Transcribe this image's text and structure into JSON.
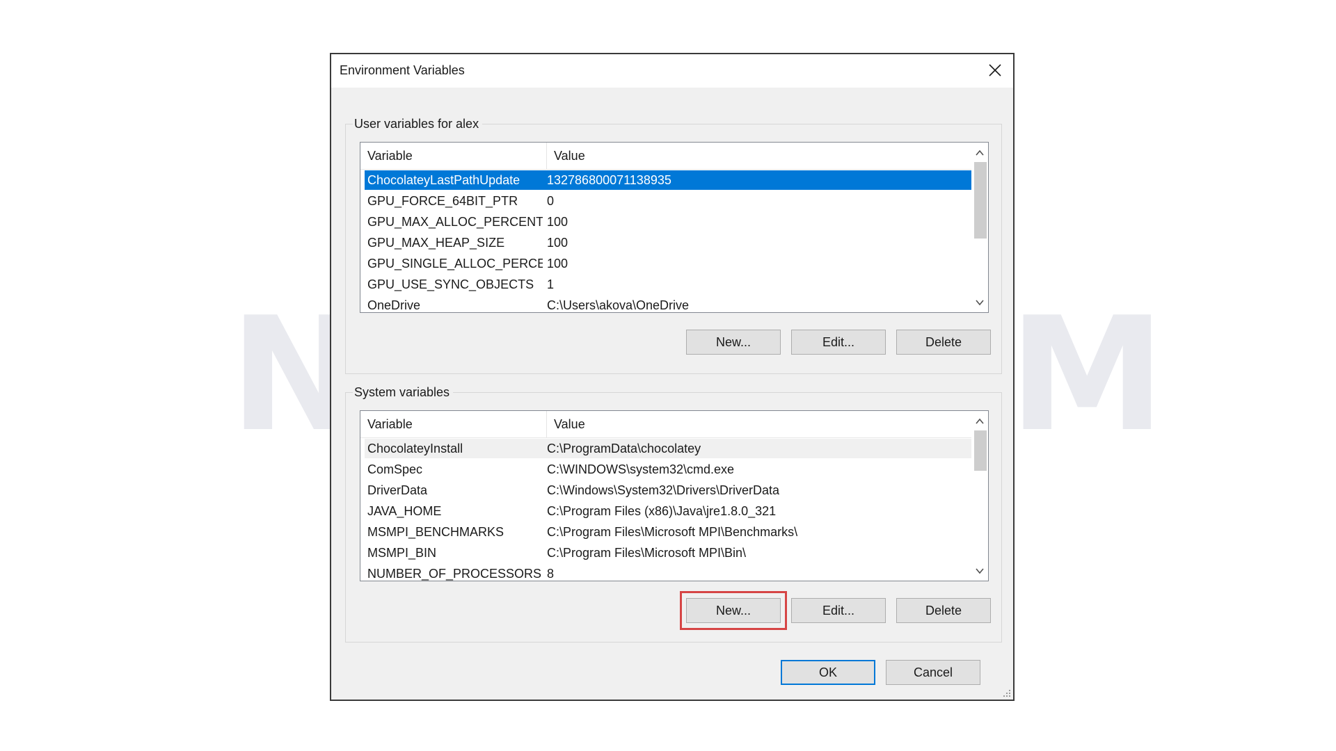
{
  "watermark": "NeuronVM",
  "window": {
    "title": "Environment Variables"
  },
  "user_vars": {
    "legend": "User variables for alex",
    "columns": [
      "Variable",
      "Value"
    ],
    "rows": [
      {
        "name": "ChocolateyLastPathUpdate",
        "value": "132786800071138935",
        "selected": true
      },
      {
        "name": "GPU_FORCE_64BIT_PTR",
        "value": "0"
      },
      {
        "name": "GPU_MAX_ALLOC_PERCENT",
        "value": "100"
      },
      {
        "name": "GPU_MAX_HEAP_SIZE",
        "value": "100"
      },
      {
        "name": "GPU_SINGLE_ALLOC_PERCE...",
        "value": "100"
      },
      {
        "name": "GPU_USE_SYNC_OBJECTS",
        "value": "1"
      },
      {
        "name": "OneDrive",
        "value": "C:\\Users\\akova\\OneDrive"
      }
    ],
    "buttons": {
      "new": "New...",
      "edit": "Edit...",
      "delete": "Delete"
    }
  },
  "system_vars": {
    "legend": "System variables",
    "columns": [
      "Variable",
      "Value"
    ],
    "rows": [
      {
        "name": "ChocolateyInstall",
        "value": "C:\\ProgramData\\chocolatey",
        "hover": true
      },
      {
        "name": "ComSpec",
        "value": "C:\\WINDOWS\\system32\\cmd.exe"
      },
      {
        "name": "DriverData",
        "value": "C:\\Windows\\System32\\Drivers\\DriverData"
      },
      {
        "name": "JAVA_HOME",
        "value": "C:\\Program Files (x86)\\Java\\jre1.8.0_321"
      },
      {
        "name": "MSMPI_BENCHMARKS",
        "value": "C:\\Program Files\\Microsoft MPI\\Benchmarks\\"
      },
      {
        "name": "MSMPI_BIN",
        "value": "C:\\Program Files\\Microsoft MPI\\Bin\\"
      },
      {
        "name": "NUMBER_OF_PROCESSORS",
        "value": "8"
      }
    ],
    "buttons": {
      "new": "New...",
      "edit": "Edit...",
      "delete": "Delete"
    }
  },
  "footer": {
    "ok": "OK",
    "cancel": "Cancel"
  },
  "icons": {
    "close": "close-icon",
    "scroll_up": "chevron-up-icon",
    "scroll_down": "chevron-down-icon",
    "resize": "resize-grip-icon"
  },
  "colors": {
    "selection": "#0078d7",
    "highlight": "#d64545",
    "watermark": "#e9eaef"
  }
}
